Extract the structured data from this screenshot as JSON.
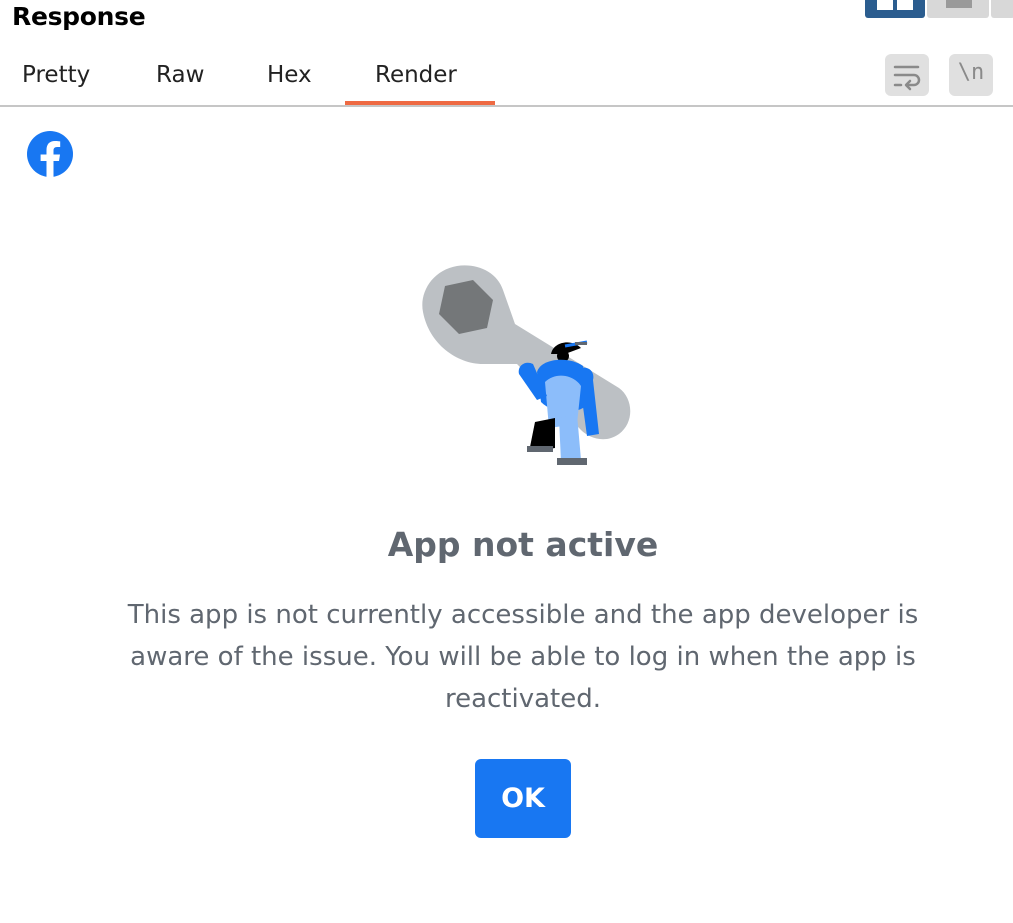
{
  "panel": {
    "title": "Response"
  },
  "tabs": [
    {
      "label": "Pretty",
      "active": false
    },
    {
      "label": "Raw",
      "active": false
    },
    {
      "label": "Hex",
      "active": false
    },
    {
      "label": "Render",
      "active": true
    }
  ],
  "toolbar": {
    "wrap_icon": "word-wrap-icon",
    "newline_label": "\\n"
  },
  "colors": {
    "active_tab_underline": "#ee6a43",
    "facebook_blue": "#1877f2",
    "layout_active": "#2b5d8f",
    "text_gray": "#606770"
  },
  "rendered_page": {
    "logo_icon": "facebook-logo-icon",
    "illustration_icon": "wrench-worker-illustration",
    "heading": "App not active",
    "message_lines": [
      "This app is not currently accessible and the app developer is",
      "aware of the issue. You will be able to log in when the app is",
      "reactivated."
    ],
    "ok_label": "OK"
  }
}
